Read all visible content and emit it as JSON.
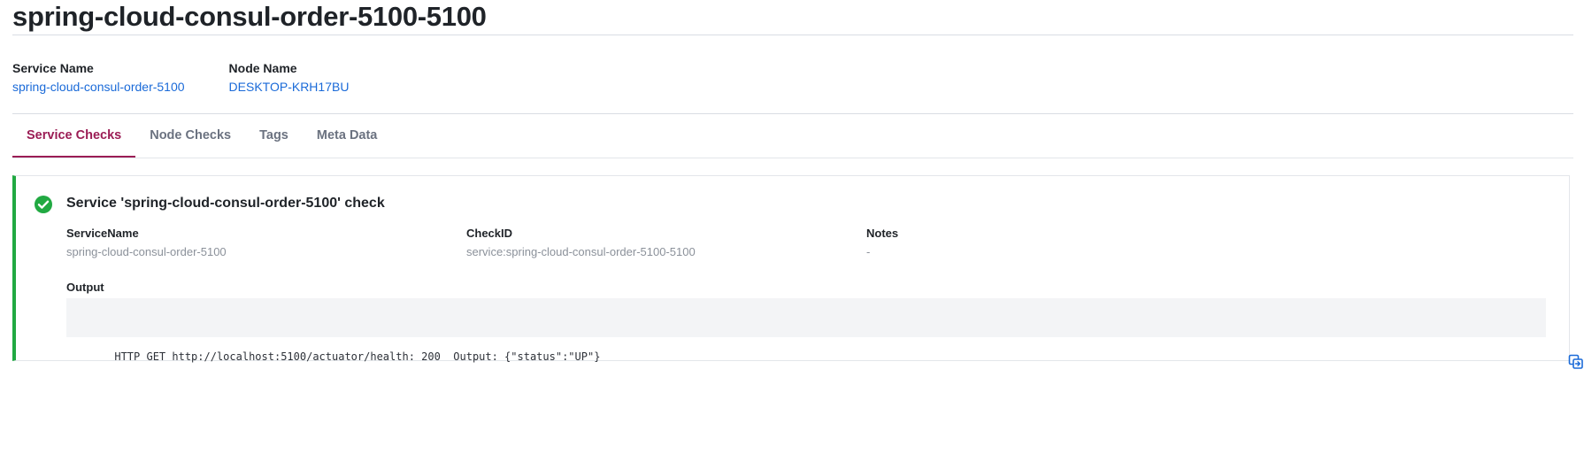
{
  "page": {
    "title": "spring-cloud-consul-order-5100-5100"
  },
  "meta": {
    "service_name_label": "Service Name",
    "service_name_value": "spring-cloud-consul-order-5100",
    "node_name_label": "Node Name",
    "node_name_value": "DESKTOP-KRH17BU"
  },
  "tabs": [
    {
      "label": "Service Checks",
      "active": true
    },
    {
      "label": "Node Checks",
      "active": false
    },
    {
      "label": "Tags",
      "active": false
    },
    {
      "label": "Meta Data",
      "active": false
    }
  ],
  "check": {
    "status_icon": "check-circle-icon",
    "status_color": "#21a942",
    "title": "Service 'spring-cloud-consul-order-5100' check",
    "fields": [
      {
        "label": "ServiceName",
        "value": "spring-cloud-consul-order-5100"
      },
      {
        "label": "CheckID",
        "value": "service:spring-cloud-consul-order-5100-5100"
      },
      {
        "label": "Notes",
        "value": "-"
      }
    ],
    "output_label": "Output",
    "output_text": "HTTP GET http://localhost:5100/actuator/health: 200  Output: {\"status\":\"UP\"}",
    "copy_icon": "copy-icon"
  },
  "colors": {
    "accent": "#9b1d55",
    "link": "#1a6ad8",
    "success": "#21a942"
  }
}
